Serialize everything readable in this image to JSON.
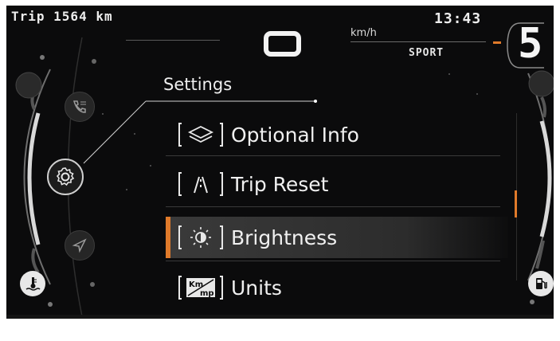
{
  "status": {
    "trip": "Trip 1564 km",
    "clock": "13:43",
    "speed_unit": "km/h",
    "mode": "SPORT",
    "gear": "5"
  },
  "menu": {
    "title": "Settings",
    "items": [
      {
        "label": "Optional Info",
        "icon": "layers-icon",
        "selected": false
      },
      {
        "label": "Trip Reset",
        "icon": "trip-reset-icon",
        "selected": false
      },
      {
        "label": "Brightness",
        "icon": "brightness-icon",
        "selected": true
      },
      {
        "label": "Units",
        "icon": "units-icon",
        "selected": false
      }
    ]
  },
  "side_icons": {
    "left": [
      "phone-list-icon",
      "settings-gear-icon",
      "navigation-icon",
      "coolant-temperature-icon"
    ],
    "right": [
      "fuel-pump-icon"
    ]
  },
  "units_icon_text": {
    "top": "Km",
    "bottom": "mp"
  },
  "colors": {
    "accent": "#e07a2a",
    "background": "#0b0b0c",
    "text": "#f0f0f0"
  }
}
